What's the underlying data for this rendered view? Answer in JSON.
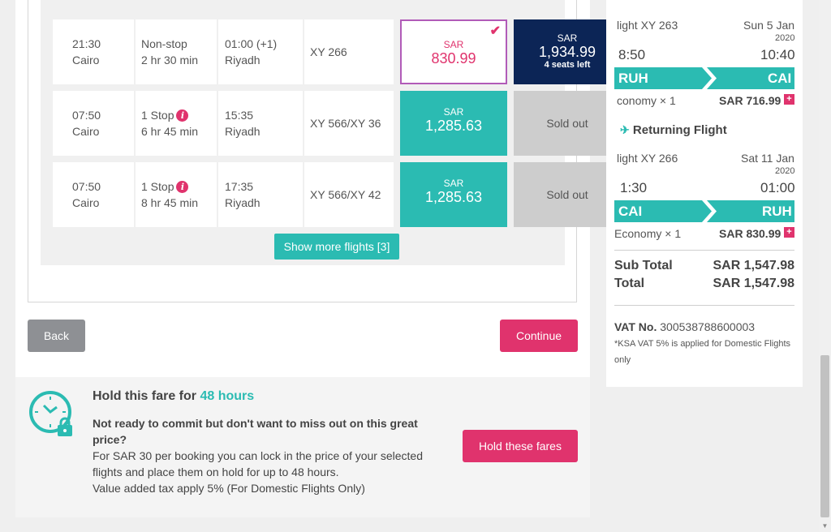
{
  "flights": [
    {
      "dep_time": "21:30",
      "dep_city": "Cairo",
      "stops": "Non-stop",
      "duration": "2 hr 30 min",
      "arr_time": "01:00 (+1)",
      "arr_city": "Riyadh",
      "flight_no": "XY 266",
      "fare1": {
        "currency": "SAR",
        "amount": "830.99",
        "state": "selected"
      },
      "fare2": {
        "currency": "SAR",
        "amount": "1,934.99",
        "seats": "4 seats left",
        "state": "available"
      }
    },
    {
      "dep_time": "07:50",
      "dep_city": "Cairo",
      "stops": "1 Stop",
      "duration": "6 hr 45 min",
      "arr_time": "15:35",
      "arr_city": "Riyadh",
      "flight_no": "XY 566/XY 36",
      "fare1": {
        "currency": "SAR",
        "amount": "1,285.63",
        "state": "available"
      },
      "fare2": {
        "label": "Sold out",
        "state": "soldout"
      }
    },
    {
      "dep_time": "07:50",
      "dep_city": "Cairo",
      "stops": "1 Stop",
      "duration": "8 hr 45 min",
      "arr_time": "17:35",
      "arr_city": "Riyadh",
      "flight_no": "XY 566/XY 42",
      "fare1": {
        "currency": "SAR",
        "amount": "1,285.63",
        "state": "available"
      },
      "fare2": {
        "label": "Sold out",
        "state": "soldout"
      }
    }
  ],
  "show_more_label": "Show more flights [3]",
  "buttons": {
    "back": "Back",
    "continue": "Continue",
    "hold": "Hold these fares"
  },
  "hold": {
    "title_prefix": "Hold this fare for",
    "title_highlight": "48 hours",
    "bold_text": "Not ready to commit but don't want to miss out on this great price?",
    "line1": "For SAR 30 per booking you can lock in the price of your selected flights and place them on hold for up to 48 hours.",
    "line2": "Value added tax apply 5% (For Domestic Flights Only)"
  },
  "summary": {
    "departing": {
      "flight": "light XY 263",
      "date": "Sun 5 Jan",
      "year": "2020",
      "dep_time": "8:50",
      "arr_time": "10:40",
      "from": "RUH",
      "to": "CAI",
      "cabin": "conomy × 1",
      "price": "SAR 716.99"
    },
    "returning_title": "Returning Flight",
    "returning": {
      "flight": "light XY 266",
      "date": "Sat 11 Jan",
      "year": "2020",
      "dep_time": "1:30",
      "arr_time": "01:00",
      "from": "CAI",
      "to": "RUH",
      "cabin": "Economy × 1",
      "price": "SAR 830.99"
    },
    "sub_total_label": "Sub Total",
    "sub_total": "SAR 1,547.98",
    "total_label": "Total",
    "total": "SAR 1,547.98",
    "vat_label": "VAT No.",
    "vat_no": "300538788600003",
    "vat_note": "*KSA VAT 5% is applied for Domestic Flights only"
  },
  "colors": {
    "teal": "#2bbbb2",
    "navy": "#0c2556",
    "pink": "#e0336d",
    "soldout": "#cdcdcd",
    "selected_border": "#b15bb8"
  }
}
